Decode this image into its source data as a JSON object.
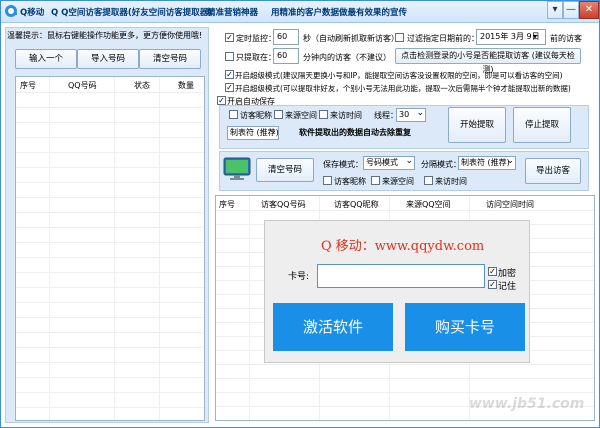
{
  "title": {
    "app_name": "Q移动",
    "app_subtitle": "Q Q空间访客提取器(好友空间访客提取器)",
    "slogan1": "精准营销神器",
    "slogan2": "用精准的客户数据做最有效果的宣传"
  },
  "window_controls": {
    "menu": "▾",
    "min": "—",
    "close": "✕"
  },
  "left": {
    "hint": "温馨提示：鼠标右键能操作功能更多，更方便你使用哦!",
    "buttons": [
      "输入一个",
      "导入号码",
      "清空号码"
    ],
    "columns": [
      "序号",
      "QQ号码",
      "状态",
      "数量"
    ]
  },
  "options": {
    "timer_label": "定时监控：",
    "timer_value": "60",
    "timer_suffix": "秒（自动刷新抓取新访客）",
    "filter_date_label": "过滤指定日期前的：",
    "date_value": "2015年 3月 9日",
    "filter_date_suffix": "前的访客",
    "only_extract_label": "只提取在：",
    "only_extract_value": "60",
    "only_extract_suffix": "分钟内的访客（不建议）",
    "detect_button": "点击检测登录的小号是否能提取访客 (建议每天检测)",
    "super_mode1": "开启超级模式(建议隔天更换小号和IP，能提取空间访客没设置权限的空间，即是可以看访客的空间)",
    "super_mode2": "开启超级模式(可以提取非好友，个别小号无法用此功能，提取一次后需隔半个钟才能提取出新的数据)",
    "auto_save": "开启自动保存",
    "visitor_nick": "访客昵称",
    "source_space": "来源空间",
    "visit_time": "来访时间",
    "threads_label": "线程：",
    "threads_value": "30",
    "tab_format": "制表符 (推荐)",
    "dedupe_note": "软件提取出的数据自动去除重复",
    "start_button": "开始提取",
    "stop_button": "停止提取"
  },
  "export": {
    "clear_button": "清空号码",
    "save_mode_label": "保存模式：",
    "save_mode_value": "号码模式",
    "sep_mode_label": "分隔模式：",
    "sep_mode_value": "制表符 (推荐)",
    "export_button": "导出访客",
    "visitor_nick": "访客昵称",
    "source_space": "来源空间",
    "visit_time": "来访时间"
  },
  "results": {
    "columns": [
      "序号",
      "访客QQ号码",
      "访客QQ昵称",
      "来源QQ空间",
      "访问空间时间"
    ]
  },
  "dialog": {
    "brand": "Q 移动：www.qqydw.com",
    "card_label": "卡号:",
    "card_value": "",
    "encrypt": "加密",
    "remember": "记住",
    "activate": "激活软件",
    "buy": "购买卡号"
  },
  "watermark": "www.jb51.com",
  "colors": {
    "accent": "#1a8fe8",
    "panel": "#dbe9f8",
    "brand_red": "#e0301e"
  }
}
